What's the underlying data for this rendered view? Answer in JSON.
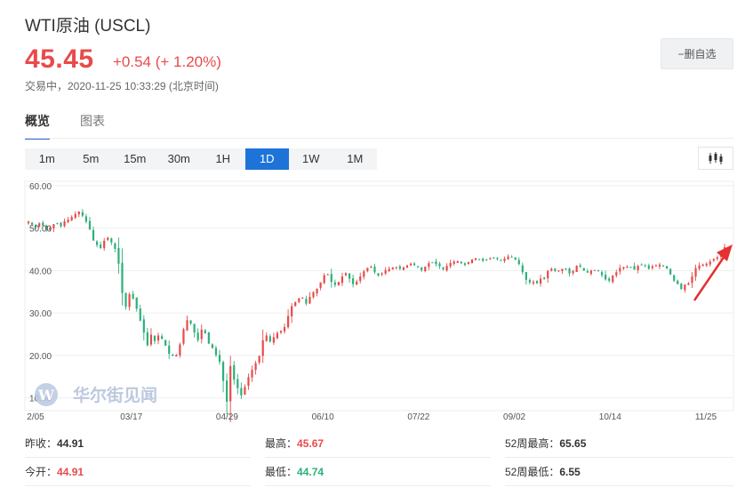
{
  "header": {
    "title": "WTI原油 (USCL)",
    "price": "45.45",
    "change": "+0.54 (+ 1.20%)",
    "status": "交易中，2020-11-25 10:33:29 (北京时间)",
    "watch_label": "−删自选"
  },
  "tabs": [
    {
      "label": "概览",
      "active": true
    },
    {
      "label": "图表",
      "active": false
    }
  ],
  "periods": [
    {
      "label": "1m"
    },
    {
      "label": "5m"
    },
    {
      "label": "15m"
    },
    {
      "label": "30m"
    },
    {
      "label": "1H"
    },
    {
      "label": "1D",
      "active": true
    },
    {
      "label": "1W"
    },
    {
      "label": "1M"
    }
  ],
  "watermark": "华尔街见闻",
  "chart_data": {
    "type": "candlestick",
    "x_ticks": [
      "2/05",
      "03/17",
      "04/29",
      "06/10",
      "07/22",
      "09/02",
      "10/14",
      "11/25"
    ],
    "y_ticks": [
      "60.00",
      "50.00",
      "40.00",
      "30.00",
      "20.00",
      "10.00"
    ],
    "ylim": [
      7,
      61
    ],
    "up_color": "#e94a4a",
    "down_color": "#2bb07a",
    "closes": [
      51.5,
      50.8,
      50.3,
      51.1,
      50.6,
      49.7,
      50.1,
      50.9,
      51.0,
      50.4,
      51.6,
      52.0,
      52.6,
      53.3,
      53.9,
      52.9,
      51.5,
      49.7,
      47.1,
      46.0,
      45.3,
      47.0,
      47.7,
      46.6,
      45.1,
      41.6,
      34.7,
      31.5,
      34.4,
      33.4,
      31.0,
      28.2,
      25.4,
      22.4,
      24.9,
      23.4,
      24.7,
      23.9,
      22.3,
      20.4,
      19.9,
      20.1,
      22.6,
      26.2,
      28.3,
      27.5,
      25.4,
      23.6,
      26.1,
      25.2,
      22.8,
      21.7,
      20.1,
      18.5,
      14.0,
      9.1,
      17.5,
      14.3,
      12.3,
      10.6,
      12.6,
      14.9,
      16.6,
      18.2,
      19.9,
      23.6,
      24.7,
      23.3,
      24.3,
      25.3,
      25.8,
      26.7,
      29.3,
      31.6,
      32.6,
      33.4,
      33.6,
      32.2,
      33.8,
      34.9,
      35.7,
      37.2,
      38.9,
      39.1,
      37.3,
      36.6,
      37.3,
      38.6,
      39.4,
      38.1,
      36.8,
      37.4,
      38.6,
      39.8,
      40.6,
      40.9,
      39.6,
      38.8,
      39.3,
      40.1,
      40.4,
      40.7,
      40.8,
      40.4,
      40.7,
      41.2,
      41.6,
      41.3,
      40.8,
      40.1,
      40.9,
      41.7,
      41.9,
      41.5,
      41.0,
      40.3,
      41.1,
      41.8,
      42.1,
      42.2,
      41.7,
      41.3,
      42.0,
      42.6,
      42.9,
      42.6,
      42.3,
      42.5,
      42.9,
      43.0,
      42.7,
      42.4,
      42.8,
      43.3,
      43.1,
      42.5,
      41.5,
      39.6,
      37.8,
      37.2,
      37.3,
      37.0,
      38.1,
      38.0,
      39.9,
      40.4,
      39.9,
      40.0,
      40.4,
      40.2,
      39.3,
      39.9,
      41.1,
      40.9,
      40.0,
      39.5,
      40.0,
      40.1,
      39.9,
      38.9,
      37.9,
      37.6,
      38.8,
      39.6,
      40.6,
      40.8,
      40.9,
      40.8,
      40.2,
      41.1,
      41.3,
      41.0,
      40.4,
      41.0,
      41.2,
      41.4,
      41.1,
      40.5,
      39.1,
      37.6,
      36.8,
      35.6,
      36.7,
      37.0,
      38.6,
      40.6,
      41.2,
      41.4,
      41.6,
      42.1,
      42.7,
      43.1,
      43.9,
      45.5
    ]
  },
  "stats": [
    {
      "label": "昨收：",
      "value": "44.91",
      "color": ""
    },
    {
      "label": "最高：",
      "value": "45.67",
      "color": "red"
    },
    {
      "label": "52周最高：",
      "value": "65.65",
      "color": ""
    },
    {
      "label": "今开：",
      "value": "44.91",
      "color": "red"
    },
    {
      "label": "最低：",
      "value": "44.74",
      "color": "green"
    },
    {
      "label": "52周最低：",
      "value": "6.55",
      "color": ""
    }
  ]
}
